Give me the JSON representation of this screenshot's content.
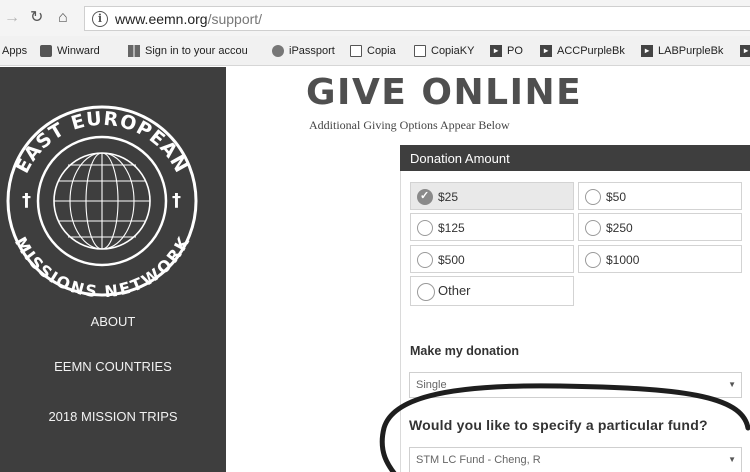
{
  "browser": {
    "url_domain": "www.eemn.org",
    "url_path": "/support/",
    "nav_icons": [
      "back-arrow-icon",
      "reload-icon",
      "home-icon",
      "info-icon"
    ]
  },
  "bookmarks": [
    {
      "label": "Apps",
      "icon": "apps-icon"
    },
    {
      "label": "Winward",
      "icon": "winward-icon"
    },
    {
      "label": "Sign in to your accou",
      "icon": "grid-icon"
    },
    {
      "label": "iPassport",
      "icon": "ipassport-icon"
    },
    {
      "label": "Copia",
      "icon": "page-icon"
    },
    {
      "label": "CopiaKY",
      "icon": "page-icon"
    },
    {
      "label": "PO",
      "icon": "bookmark-icon"
    },
    {
      "label": "ACCPurpleBk",
      "icon": "bookmark-icon"
    },
    {
      "label": "LABPurpleBk",
      "icon": "bookmark-icon"
    }
  ],
  "logo": {
    "top_text": "EAST EUROPEAN",
    "bottom_text": "MISSIONS NETWORK"
  },
  "sidebar": {
    "items": [
      "ABOUT",
      "EEMN COUNTRIES",
      "2018 MISSION TRIPS"
    ]
  },
  "page": {
    "title": "GIVE ONLINE",
    "subtitle": "Additional Giving Options Appear Below"
  },
  "donation": {
    "header": "Donation Amount",
    "options": [
      "$25",
      "$50",
      "$125",
      "$250",
      "$500",
      "$1000",
      "Other"
    ],
    "selected": "$25",
    "frequency_label": "Make my donation",
    "frequency_value": "Single",
    "fund_label": "Would you like to specify a particular fund?",
    "fund_value": "STM LC Fund - Cheng, R"
  },
  "colors": {
    "sidebar_bg": "#3e3e3e",
    "panel_header_bg": "#3e3e3e",
    "title_text": "#4f4f4f"
  }
}
